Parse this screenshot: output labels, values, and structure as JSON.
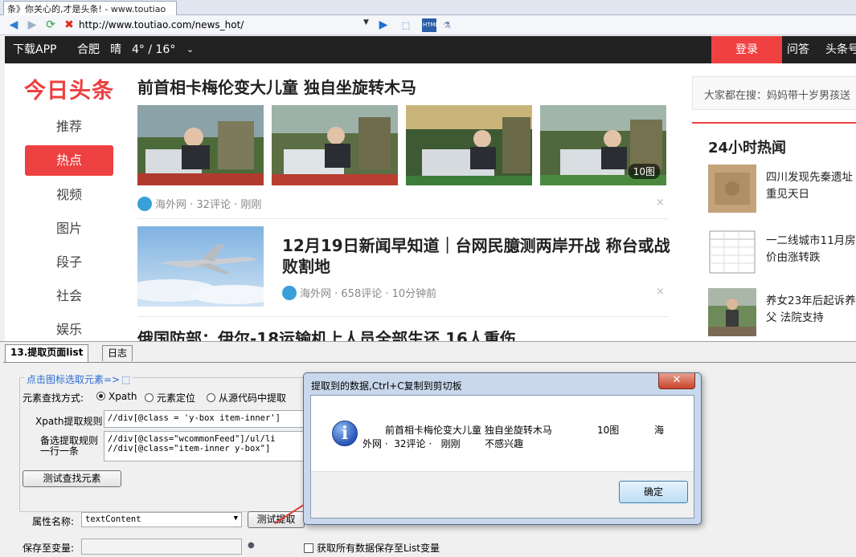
{
  "browser": {
    "tab_title": "条》你关心的,才是头条! - www.toutiao",
    "url": "http://www.toutiao.com/news_hot/"
  },
  "topbar": {
    "download": "下载APP",
    "city": "合肥",
    "weather": "晴",
    "temp": "4° / 16°",
    "login": "登录",
    "qa": "问答",
    "toutiaohao": "头条号"
  },
  "sidebar": {
    "logo": "今日头条",
    "items": [
      {
        "label": "推荐"
      },
      {
        "label": "热点"
      },
      {
        "label": "视频"
      },
      {
        "label": "图片"
      },
      {
        "label": "段子"
      },
      {
        "label": "社会"
      },
      {
        "label": "娱乐"
      }
    ]
  },
  "feed": {
    "item1": {
      "title": "前首相卡梅伦变大儿童 独自坐旋转木马",
      "image_count": "10图",
      "meta": "海外网 · 32评论 · 刚刚"
    },
    "item2": {
      "title": "12月19日新闻早知道｜台网民臆测两岸开战 称台或战败割地",
      "meta": "海外网 · 658评论 · 10分钟前"
    },
    "item3": {
      "title": "俄国防部：伊尔-18运输机上人员全部生还 16人重伤"
    },
    "close": "×"
  },
  "right": {
    "search_hint": "大家都在搜：妈妈带十岁男孩送",
    "hot_title": "24小时热闻",
    "hot_items": [
      {
        "title": "四川发现先秦遗址重见天日"
      },
      {
        "title": "一二线城市11月房价由涨转跌"
      },
      {
        "title": "养女23年后起诉养父 法院支持"
      }
    ]
  },
  "panel": {
    "tabs": [
      "13.提取页面list",
      "日志"
    ],
    "legend": "点击图标选取元素=>",
    "method_label": "元素查找方式:",
    "methods": [
      "Xpath",
      "元素定位",
      "从源代码中提取"
    ],
    "xpath_label": "Xpath提取规则",
    "xpath_value": "//div[@class = 'y-box item-inner']",
    "alt_label_1": "备选提取规则",
    "alt_label_2": "一行一条",
    "alt_value_1": "//div[@class=\"wcommonFeed\"]/ul/li",
    "alt_value_2": "//div[@class=\"item-inner y-box\"]",
    "test_find_button": "测试查找元素",
    "attr_label": "属性名称:",
    "attr_value": "textContent",
    "test_extract_button": "测试提取",
    "save_label": "保存至变量:",
    "save_list_label": "获取所有数据保存至List变量"
  },
  "dialog": {
    "title": "提取到的数据,Ctrl+C复制到剪切板",
    "close": "✕",
    "line1": "前首相卡梅伦变大儿童 独自坐旋转木马",
    "line1_count": "10图",
    "line1_tail": "海",
    "line2": "外网 ·  32评论 ·   刚刚        不感兴趣",
    "ok": "确定"
  },
  "colors": {
    "brand_red": "#ed4040",
    "topbar_bg": "#222222",
    "link_blue": "#2a6bd1"
  }
}
